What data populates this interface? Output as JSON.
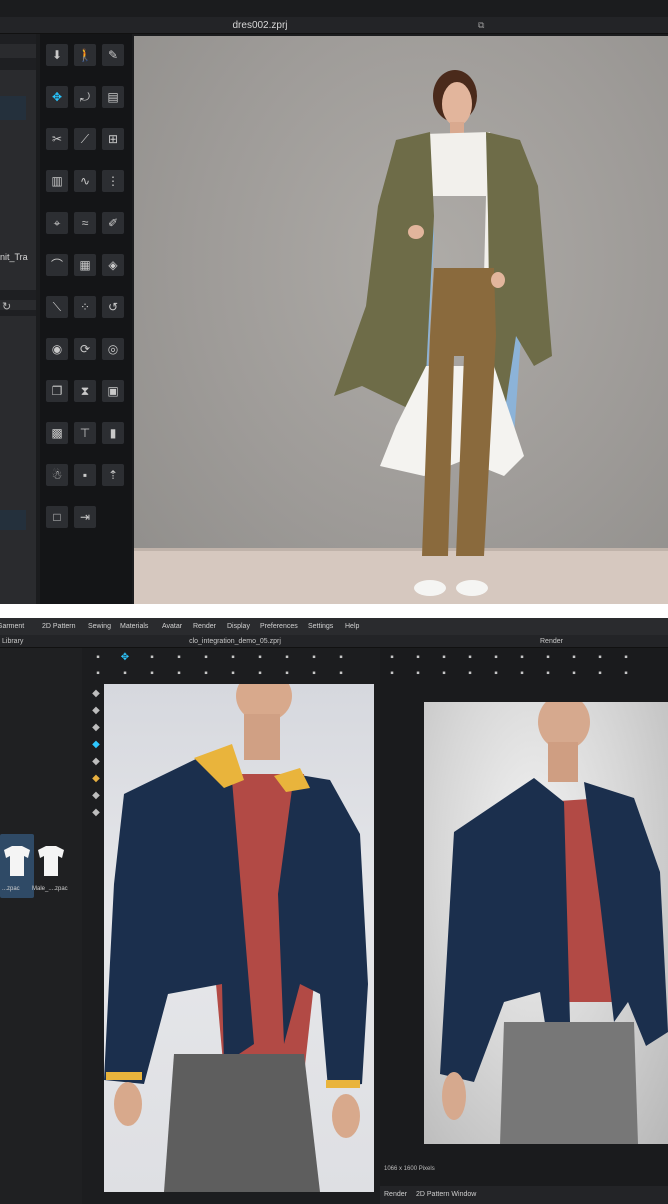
{
  "top_window": {
    "title": "dres002.zprj",
    "left_panel_label": "nit_Tra",
    "toolbar_icons": [
      "arrow-down-icon",
      "walk-icon",
      "pen-icon",
      "move-icon",
      "fold-icon",
      "tape-icon",
      "scissor-icon",
      "fold-line-icon",
      "garment-icon",
      "shirt-icon",
      "sew-icon",
      "grid-icon",
      "pin-icon",
      "curve-icon",
      "edit-icon",
      "hanger-icon",
      "fabric-icon",
      "pattern-icon",
      "needle-icon",
      "dots-icon",
      "swirl-icon",
      "button-icon",
      "rotate-icon",
      "buttonhole-icon",
      "copy-icon",
      "zipper-icon",
      "shirt2-icon",
      "shirt3-icon",
      "tee-icon",
      "tape2-icon",
      "avatar-icon",
      "cube-icon",
      "person-arrow-icon",
      "box-icon",
      "shrink-icon"
    ]
  },
  "bottom_window": {
    "menu": [
      "Garment",
      "2D Pattern",
      "Sewing",
      "Materials",
      "Avatar",
      "Render",
      "Display",
      "Preferences",
      "Settings",
      "Help"
    ],
    "library_label": "Library",
    "tab_title": "clo_integration_demo_05.zprj",
    "render_label": "Render",
    "library_items": [
      {
        "caption": "...zpac"
      },
      {
        "caption": "Male_....zpac"
      }
    ],
    "pixels_text": "1066 x 1600 Pixels",
    "bottom_tabs": [
      "Render",
      "2D Pattern Window"
    ]
  },
  "colors": {
    "accent": "#27c6ff",
    "jacket": "#1b2f4d",
    "collar": "#e9b43c",
    "shirt": "#b24a45",
    "pants": "#5e5e5e",
    "coat": "#6e6c48",
    "trousers": "#8a6a3d"
  }
}
